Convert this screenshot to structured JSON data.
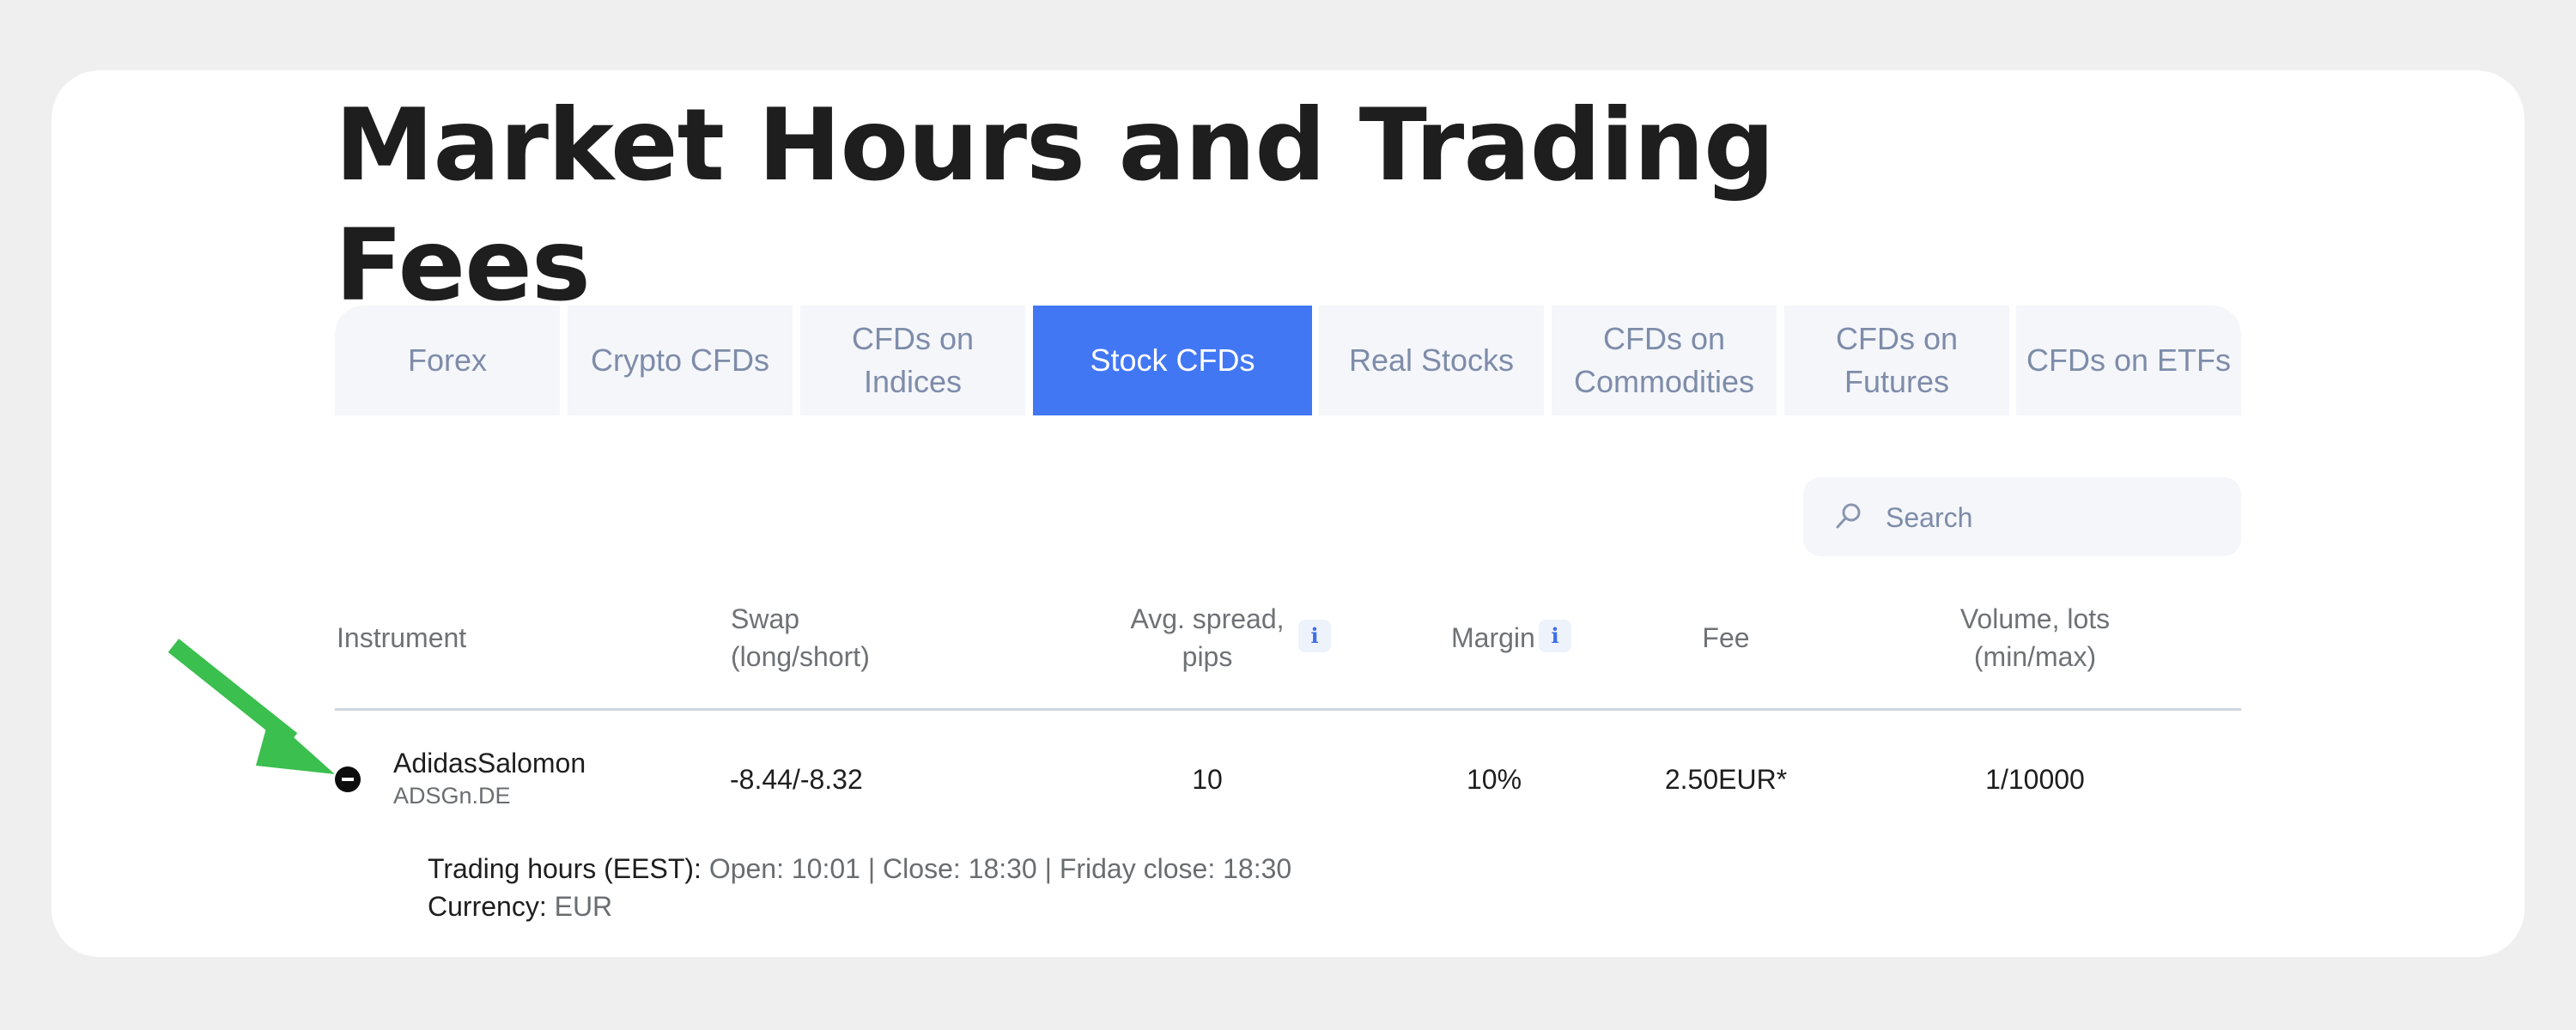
{
  "page": {
    "title": "Market Hours and Trading Fees"
  },
  "tabs": [
    {
      "label": "Forex"
    },
    {
      "label": "Crypto CFDs"
    },
    {
      "label": "CFDs on Indices"
    },
    {
      "label": "Stock CFDs",
      "active": true
    },
    {
      "label": "Real Stocks"
    },
    {
      "label": "CFDs on Commodities"
    },
    {
      "label": "CFDs on Futures"
    },
    {
      "label": "CFDs on ETFs"
    }
  ],
  "search": {
    "placeholder": "Search",
    "icon": "search-icon"
  },
  "table": {
    "headers": {
      "instrument": "Instrument",
      "swap_line1": "Swap",
      "swap_line2": "(long/short)",
      "spread_line1": "Avg. spread,",
      "spread_line2": "pips",
      "margin": "Margin",
      "fee": "Fee",
      "volume_line1": "Volume, lots",
      "volume_line2": "(min/max)",
      "info_glyph": "i"
    },
    "rows": [
      {
        "name": "AdidasSalomon",
        "code": "ADSGn.DE",
        "swap": "-8.44/-8.32",
        "spread": "10",
        "margin": "10%",
        "fee": "2.50EUR*",
        "volume": "1/10000",
        "details": {
          "hours_label": "Trading hours (EEST):",
          "hours_value": "Open: 10:01 | Close: 18:30 | Friday close: 18:30",
          "currency_label": "Currency:",
          "currency_value": "EUR"
        }
      }
    ]
  },
  "colors": {
    "accent": "#4277f4",
    "tab_bg": "#f4f6fa",
    "tab_text": "#7e8ca9",
    "annotation_arrow": "#3bbf4f"
  }
}
